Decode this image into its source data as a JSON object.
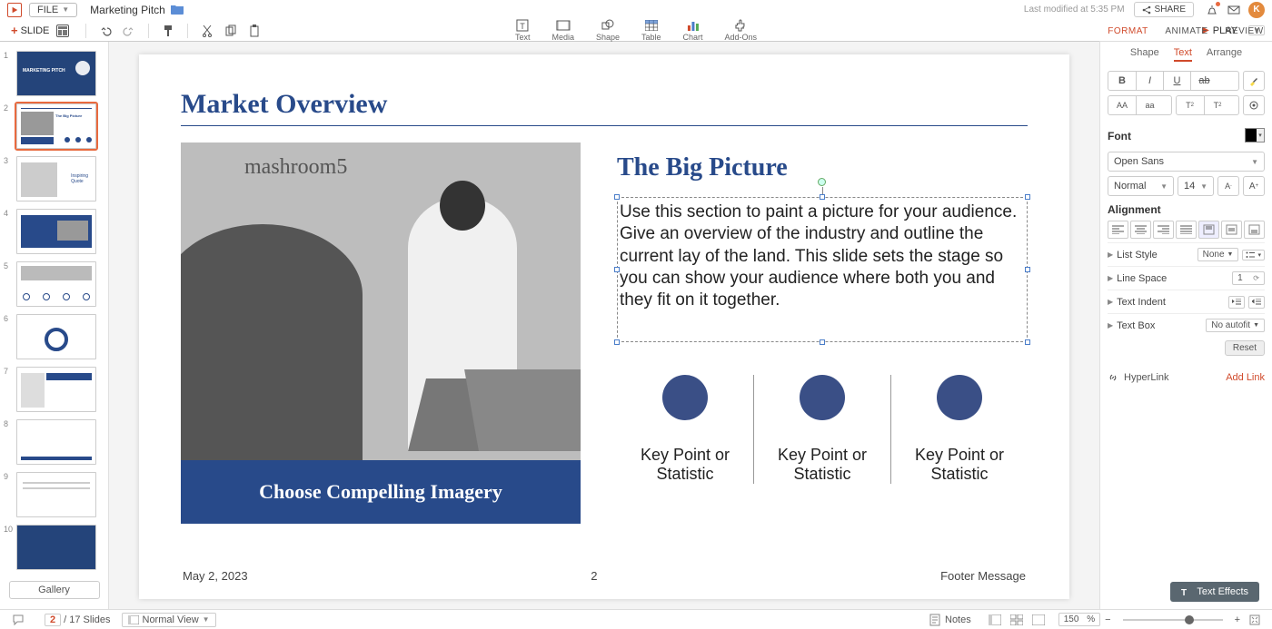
{
  "header": {
    "file_label": "FILE",
    "doc_title": "Marketing Pitch",
    "modified": "Last modified at 5:35 PM",
    "share_label": "SHARE",
    "avatar_letter": "K"
  },
  "toolbar": {
    "new_slide": "SLIDE",
    "center": {
      "text": "Text",
      "media": "Media",
      "shape": "Shape",
      "table": "Table",
      "chart": "Chart",
      "addons": "Add-Ons"
    },
    "play": "PLAY"
  },
  "top_tabs": {
    "format": "FORMAT",
    "animate": "ANIMATE",
    "review": "REVIEW"
  },
  "thumbs": {
    "count": 10,
    "selected": 2,
    "gallery": "Gallery"
  },
  "slide": {
    "title": "Market Overview",
    "image_wall_text": "mashroom5",
    "image_caption": "Choose Compelling Imagery",
    "subheading": "The Big Picture",
    "paragraph": "Use this section to paint a picture for your audience. Give an overview of the industry and outline the current lay of the land. This slide sets the stage so you can show your audience where both you and they fit on it together.",
    "key_line1": "Key Point or",
    "key_line2": "Statistic",
    "footer_left": "May 2, 2023",
    "footer_center": "2",
    "footer_right": "Footer Message"
  },
  "rpanel": {
    "tabs2": {
      "shape": "Shape",
      "text": "Text",
      "arrange": "Arrange"
    },
    "font_title": "Font",
    "font_family": "Open Sans",
    "font_style": "Normal",
    "font_size": "14",
    "alignment_title": "Alignment",
    "list_style": "List Style",
    "list_style_val": "None",
    "line_space": "Line Space",
    "line_space_val": "1",
    "text_indent": "Text Indent",
    "text_box": "Text Box",
    "text_box_val": "No autofit",
    "reset": "Reset",
    "hyperlink": "HyperLink",
    "add_link": "Add Link",
    "text_effects": "Text Effects"
  },
  "status": {
    "current": "2",
    "total": "/ 17 Slides",
    "view": "Normal View",
    "notes": "Notes",
    "zoom": "150",
    "zoom_unit": "%"
  }
}
